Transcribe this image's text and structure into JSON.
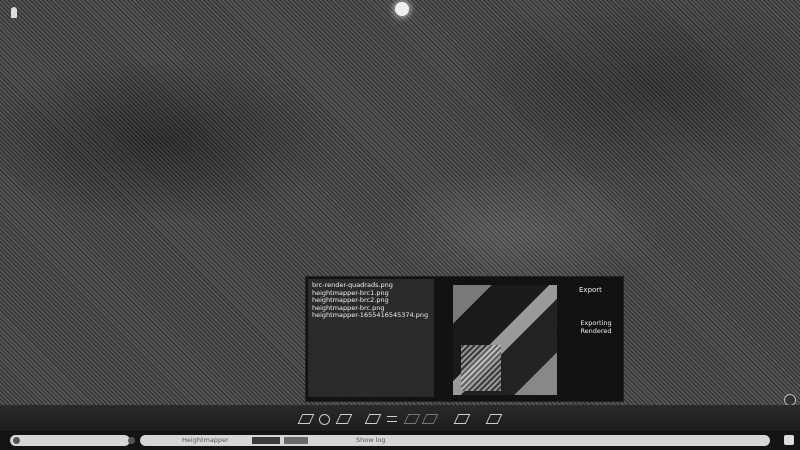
{
  "panel": {
    "files": [
      "brc-render-quadrads.png",
      "heightmapper-brc1.png",
      "heightmapper-brc2.png",
      "heightmapper-brc.png",
      "heightmapper-1655416545374.png"
    ],
    "export_label": "Export",
    "status_lines": [
      "Exporting",
      "Rendered"
    ]
  },
  "toolbar": {
    "tools": [
      {
        "name": "tool-terrain-icon"
      },
      {
        "name": "tool-orbit-icon"
      },
      {
        "name": "tool-layers-icon"
      },
      {
        "name": "tool-contour-icon"
      },
      {
        "name": "tool-wave-icon"
      },
      {
        "name": "tool-grid-icon"
      },
      {
        "name": "tool-slope-icon"
      },
      {
        "name": "tool-light-icon"
      },
      {
        "name": "tool-export-icon"
      }
    ]
  },
  "bottom": {
    "label_main": "Heightmapper",
    "label_secondary": "Show log"
  }
}
